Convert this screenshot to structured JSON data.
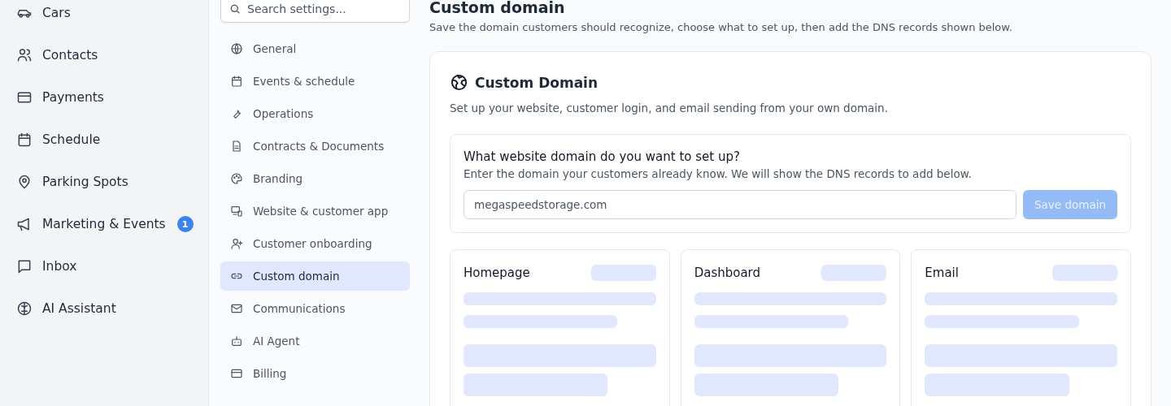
{
  "nav": {
    "items": [
      {
        "label": "Cars"
      },
      {
        "label": "Contacts"
      },
      {
        "label": "Payments"
      },
      {
        "label": "Schedule"
      },
      {
        "label": "Parking Spots"
      },
      {
        "label": "Marketing & Events",
        "badge": "1"
      },
      {
        "label": "Inbox"
      },
      {
        "label": "AI Assistant"
      }
    ]
  },
  "settings_nav": {
    "search": {
      "placeholder": "Search settings..."
    },
    "items": [
      {
        "label": "General",
        "selected": false
      },
      {
        "label": "Events & schedule",
        "selected": false
      },
      {
        "label": "Operations",
        "selected": false
      },
      {
        "label": "Contracts & Documents",
        "selected": false
      },
      {
        "label": "Branding",
        "selected": false
      },
      {
        "label": "Website & customer app",
        "selected": false
      },
      {
        "label": "Customer onboarding",
        "selected": false
      },
      {
        "label": "Custom domain",
        "selected": true
      },
      {
        "label": "Communications",
        "selected": false
      },
      {
        "label": "AI Agent",
        "selected": false
      },
      {
        "label": "Billing",
        "selected": false
      }
    ]
  },
  "page": {
    "title": "Custom domain",
    "subtitle": "Save the domain customers should recognize, choose what to set up, then add the DNS records shown below.",
    "card": {
      "title": "Custom Domain",
      "description": "Set up your website, customer login, and email sending from your own domain.",
      "domain_form": {
        "question": "What website domain do you want to set up?",
        "hint": "Enter the domain your customers already know. We will show the DNS records to add below.",
        "field": {
          "placeholder": "megaspeedstorage.com"
        },
        "button": {
          "label": "Save domain",
          "disabled": true
        }
      },
      "sections": [
        {
          "title": "Homepage",
          "loading": true
        },
        {
          "title": "Dashboard",
          "loading": true
        },
        {
          "title": "Email",
          "loading": true
        }
      ]
    }
  }
}
